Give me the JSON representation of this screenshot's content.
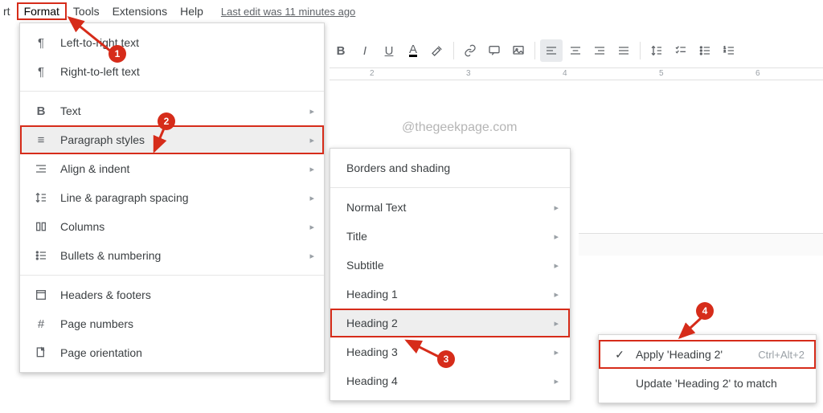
{
  "menubar": {
    "left_partial": "rt",
    "format": "Format",
    "tools": "Tools",
    "extensions": "Extensions",
    "help": "Help",
    "last_edit": "Last edit was 11 minutes ago"
  },
  "ruler": {
    "t2": "2",
    "t3": "3",
    "t4": "4",
    "t5": "5",
    "t6": "6"
  },
  "watermark": "@thegeekpage.com",
  "format_menu": {
    "ltr": "Left-to-right text",
    "rtl": "Right-to-left text",
    "text": "Text",
    "paragraph_styles": "Paragraph styles",
    "align": "Align & indent",
    "line_spacing": "Line & paragraph spacing",
    "columns": "Columns",
    "bullets": "Bullets & numbering",
    "headers_footers": "Headers & footers",
    "page_numbers": "Page numbers",
    "page_orientation": "Page orientation"
  },
  "paragraph_menu": {
    "borders": "Borders and shading",
    "normal": "Normal Text",
    "title": "Title",
    "subtitle": "Subtitle",
    "h1": "Heading 1",
    "h2": "Heading 2",
    "h3": "Heading 3",
    "h4": "Heading 4"
  },
  "heading2_menu": {
    "apply": "Apply 'Heading 2'",
    "apply_shortcut": "Ctrl+Alt+2",
    "update": "Update 'Heading 2' to match"
  },
  "callouts": {
    "c1": "1",
    "c2": "2",
    "c3": "3",
    "c4": "4"
  }
}
